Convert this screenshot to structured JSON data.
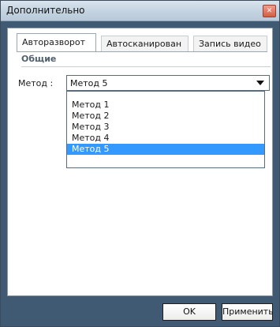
{
  "window": {
    "title": "Дополнительно",
    "close_icon": "close-icon"
  },
  "tabs": [
    {
      "label": "Авторазворот",
      "active": true
    },
    {
      "label": "Автосканирован",
      "active": false
    },
    {
      "label": "Запись видео",
      "active": false
    }
  ],
  "group": {
    "title": "Общие"
  },
  "method": {
    "label": "Метод :",
    "selected": "Метод 5",
    "options": [
      "Метод 1",
      "Метод 2",
      "Метод 3",
      "Метод 4",
      "Метод 5"
    ]
  },
  "buttons": {
    "ok": "OK",
    "apply": "Применить"
  },
  "colors": {
    "selection": "#3399ff",
    "frame": "#3f5a72"
  }
}
